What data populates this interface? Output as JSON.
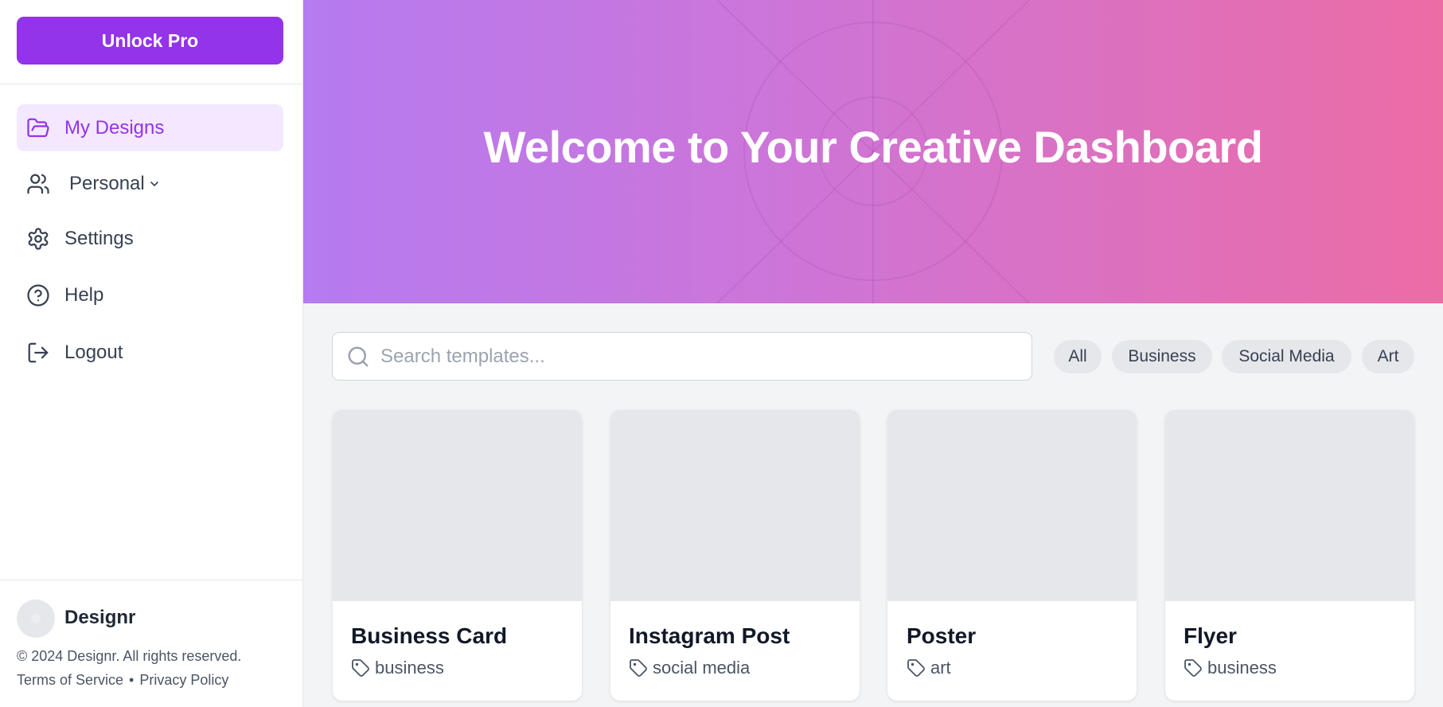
{
  "sidebar": {
    "unlock_label": "Unlock Pro",
    "items": [
      {
        "label": "My Designs",
        "icon": "folder-open-icon",
        "active": true
      },
      {
        "label": "Personal",
        "icon": "users-icon",
        "has_dropdown": true
      },
      {
        "label": "Settings",
        "icon": "gear-icon"
      },
      {
        "label": "Help",
        "icon": "help-circle-icon"
      },
      {
        "label": "Logout",
        "icon": "logout-icon"
      }
    ],
    "footer": {
      "brand": "Designr",
      "copyright": "© 2024 Designr. All rights reserved.",
      "terms": "Terms of Service",
      "separator": "•",
      "privacy": "Privacy Policy"
    }
  },
  "hero": {
    "title": "Welcome to Your Creative Dashboard"
  },
  "search": {
    "placeholder": "Search templates...",
    "value": ""
  },
  "filters": [
    "All",
    "Business",
    "Social Media",
    "Art"
  ],
  "templates": [
    {
      "title": "Business Card",
      "tag": "business"
    },
    {
      "title": "Instagram Post",
      "tag": "social media"
    },
    {
      "title": "Poster",
      "tag": "art"
    },
    {
      "title": "Flyer",
      "tag": "business"
    }
  ],
  "colors": {
    "accent": "#9333ea",
    "active_bg": "#f3e8ff",
    "hero_start": "#b57bf0",
    "hero_end": "#ec6ca5"
  }
}
